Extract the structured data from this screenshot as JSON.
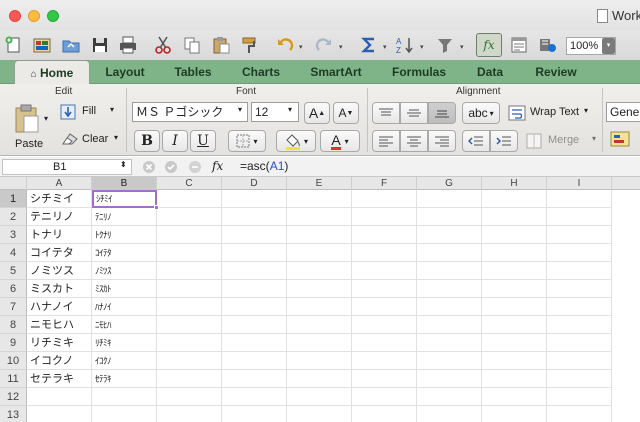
{
  "window": {
    "title": "Work",
    "zoom": "100%"
  },
  "ribbon_tabs": [
    "Home",
    "Layout",
    "Tables",
    "Charts",
    "SmartArt",
    "Formulas",
    "Data",
    "Review"
  ],
  "ribbon": {
    "edit_label": "Edit",
    "paste_label": "Paste",
    "fill_label": "Fill",
    "clear_label": "Clear",
    "font_label": "Font",
    "font_name": "ＭＳ Ｐゴシック",
    "font_size": "12",
    "bold": "B",
    "italic": "I",
    "underline": "U",
    "grow_font": "A",
    "shrink_font": "A",
    "font_color": "A",
    "alignment_label": "Alignment",
    "abc": "abc",
    "wrap_text": "Wrap Text",
    "merge": "Merge",
    "number_format": "Gener"
  },
  "formula_bar": {
    "cell_ref": "B1",
    "fx": "fx",
    "formula_prefix": "=asc(",
    "formula_ref": "A1",
    "formula_suffix": ")"
  },
  "columns": [
    "A",
    "B",
    "C",
    "D",
    "E",
    "F",
    "G",
    "H",
    "I"
  ],
  "rows": [
    "1",
    "2",
    "3",
    "4",
    "5",
    "6",
    "7",
    "8",
    "9",
    "10",
    "11",
    "12",
    "13"
  ],
  "cells": {
    "A": [
      "シチミイ",
      "テニリノ",
      "トナリ",
      "コイテタ",
      "ノミツス",
      "ミスカト",
      "ハナノイ",
      "ニモヒハ",
      "リチミキ",
      "イコクノ",
      "セテラキ"
    ],
    "B": [
      "ｼﾁﾐｲ",
      "ﾃﾆﾘﾉ",
      "ﾄｸﾅﾘ",
      "ｺｲﾃﾀ",
      "ﾉﾐﾂｽ",
      "ﾐｽｶﾄ",
      "ﾊﾅﾉｲ",
      "ﾆﾓﾋﾊ",
      "ﾘﾁﾐｷ",
      "ｲｺｸﾉ",
      "ｾﾃﾗｷ"
    ]
  },
  "selection": {
    "cell": "B1",
    "column": "B",
    "row": "1"
  },
  "colors": {
    "ribbon_green": "#7fb489",
    "selection_border": "#a46dc9"
  }
}
